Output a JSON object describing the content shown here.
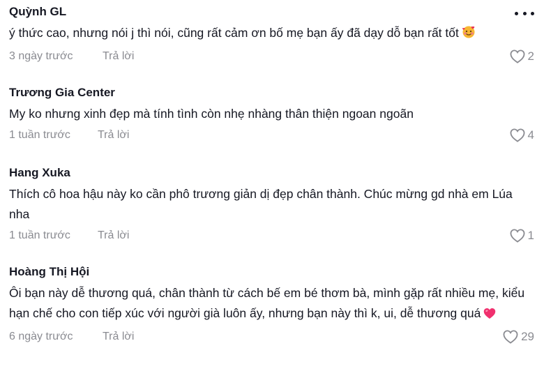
{
  "comments": [
    {
      "author": "Quỳnh GL",
      "text": "ý thức cao, nhưng nói j thì nói, cũng rất cảm ơn bố mẹ bạn ấy đã dạy dỗ bạn rất tốt",
      "emoji": "face-with-hearts-emoji",
      "time": "3 ngày trước",
      "reply_label": "Trả lời",
      "likes": "2"
    },
    {
      "author": "Trương Gia Center",
      "text": "My ko nhưng xinh đẹp mà tính tình còn nhẹ nhàng thân thiện ngoan ngoãn",
      "time": "1 tuần trước",
      "reply_label": "Trả lời",
      "likes": "4"
    },
    {
      "author": "Hang Xuka",
      "text": "Thích cô hoa hậu này ko cần phô trương giản dị đẹp chân thành. Chúc mừng gd nhà em Lúa nha",
      "time": "1 tuần trước",
      "reply_label": "Trả lời",
      "likes": "1"
    },
    {
      "author": "Hoàng Thị Hội",
      "text": "Ôi bạn này dễ thương quá, chân thành từ cách bế em bé thơm bà, mình gặp rất nhiều mẹ, kiểu hạn chế cho con tiếp xúc với người già luôn ấy, nhưng bạn này thì k, ui, dễ thương quá",
      "emoji": "pink-heart-emoji",
      "time": "6 ngày trước",
      "reply_label": "Trả lời",
      "likes": "29"
    }
  ],
  "icons": {
    "more": "more-horizontal-icon",
    "like": "heart-outline-icon"
  },
  "colors": {
    "text_primary": "#161823",
    "text_secondary": "#8a8b91",
    "heart_emoji": "#f0306e"
  }
}
